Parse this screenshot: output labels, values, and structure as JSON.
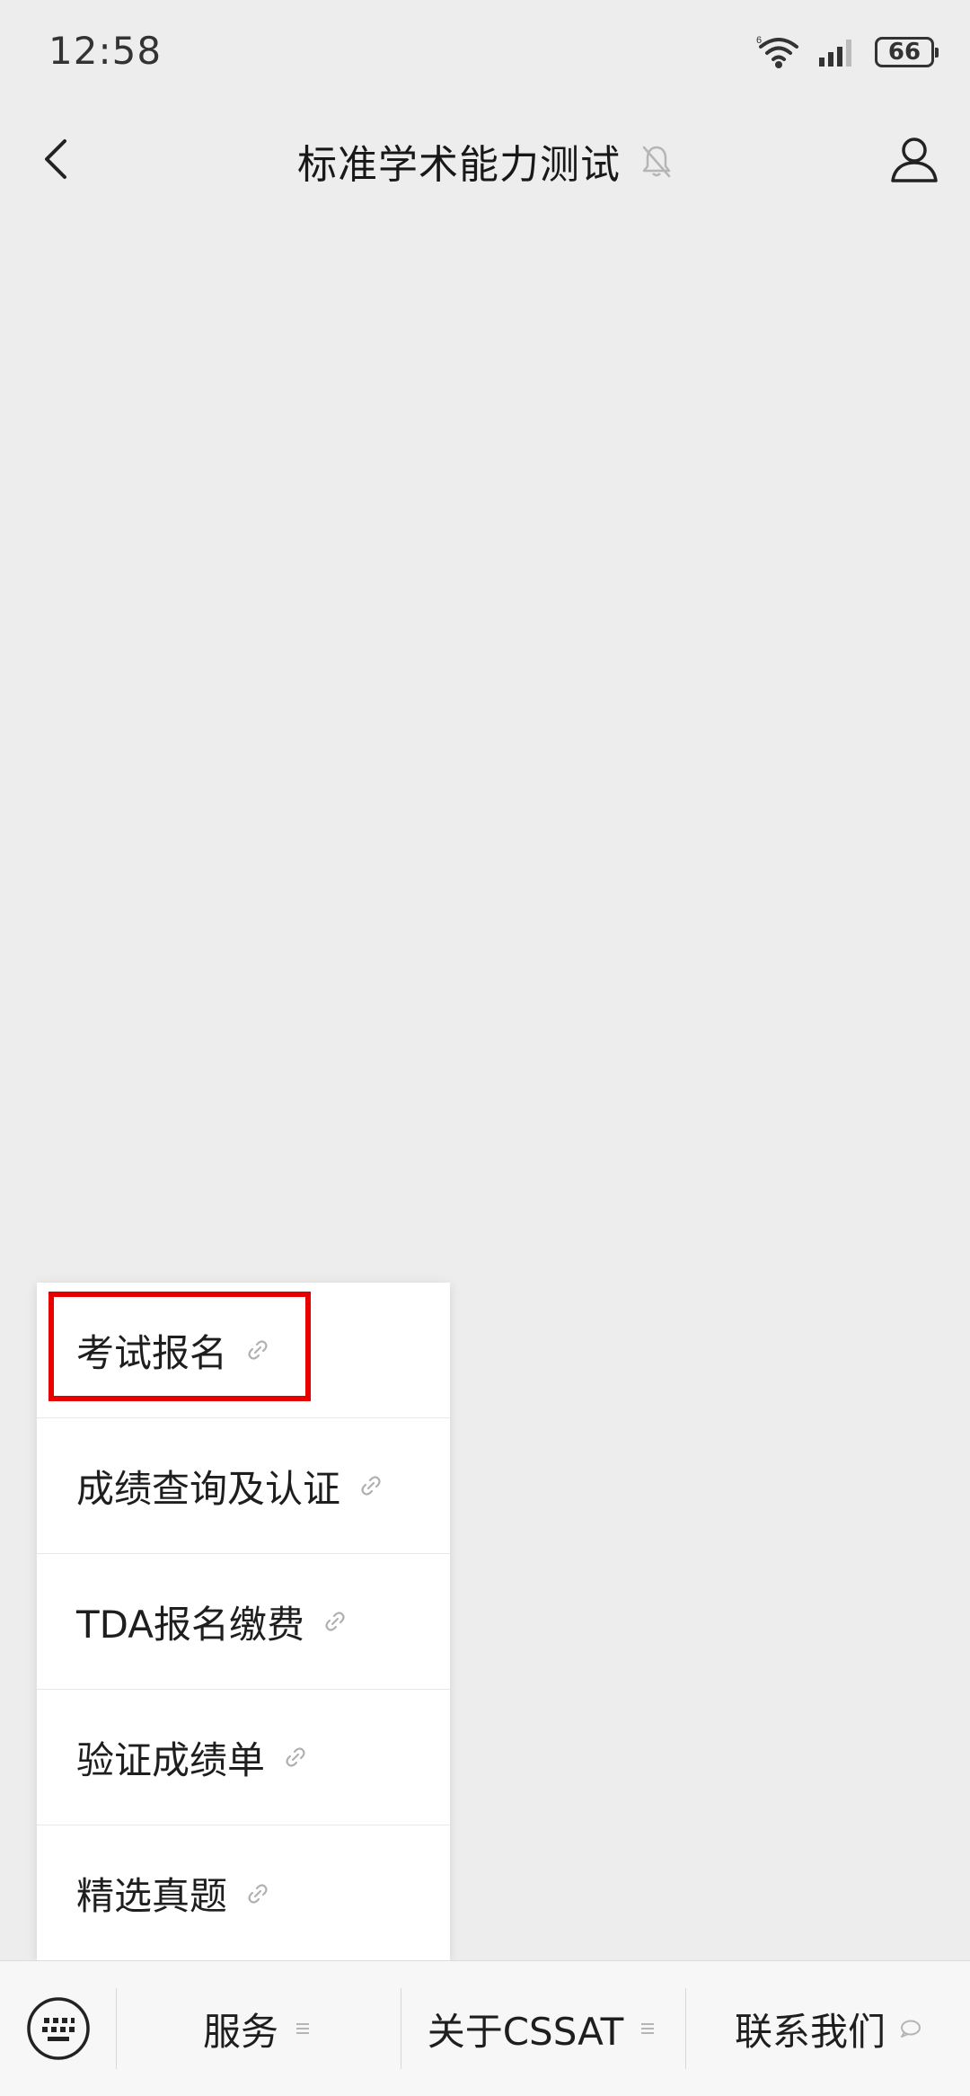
{
  "status_bar": {
    "time": "12:58",
    "battery": "66",
    "icons": [
      "wifi-icon",
      "signal-icon",
      "battery-icon"
    ]
  },
  "nav": {
    "title": "标准学术能力测试",
    "back_icon": "chevron-left-icon",
    "mute_icon": "bell-muted-icon",
    "profile_icon": "person-icon"
  },
  "popup_menu": {
    "items": [
      {
        "label": "考试报名",
        "icon": "link-icon"
      },
      {
        "label": "成绩查询及认证",
        "icon": "link-icon"
      },
      {
        "label": "TDA报名缴费",
        "icon": "link-icon"
      },
      {
        "label": "验证成绩单",
        "icon": "link-icon"
      },
      {
        "label": "精选真题",
        "icon": "link-icon"
      }
    ],
    "highlight_color": "#e60000"
  },
  "bottom_bar": {
    "keyboard_icon": "keyboard-icon",
    "tabs": [
      {
        "label": "服务",
        "icon": "menu-lines-icon"
      },
      {
        "label": "关于CSSAT",
        "icon": "menu-lines-icon"
      },
      {
        "label": "联系我们",
        "icon": "chat-bubble-icon"
      }
    ]
  }
}
